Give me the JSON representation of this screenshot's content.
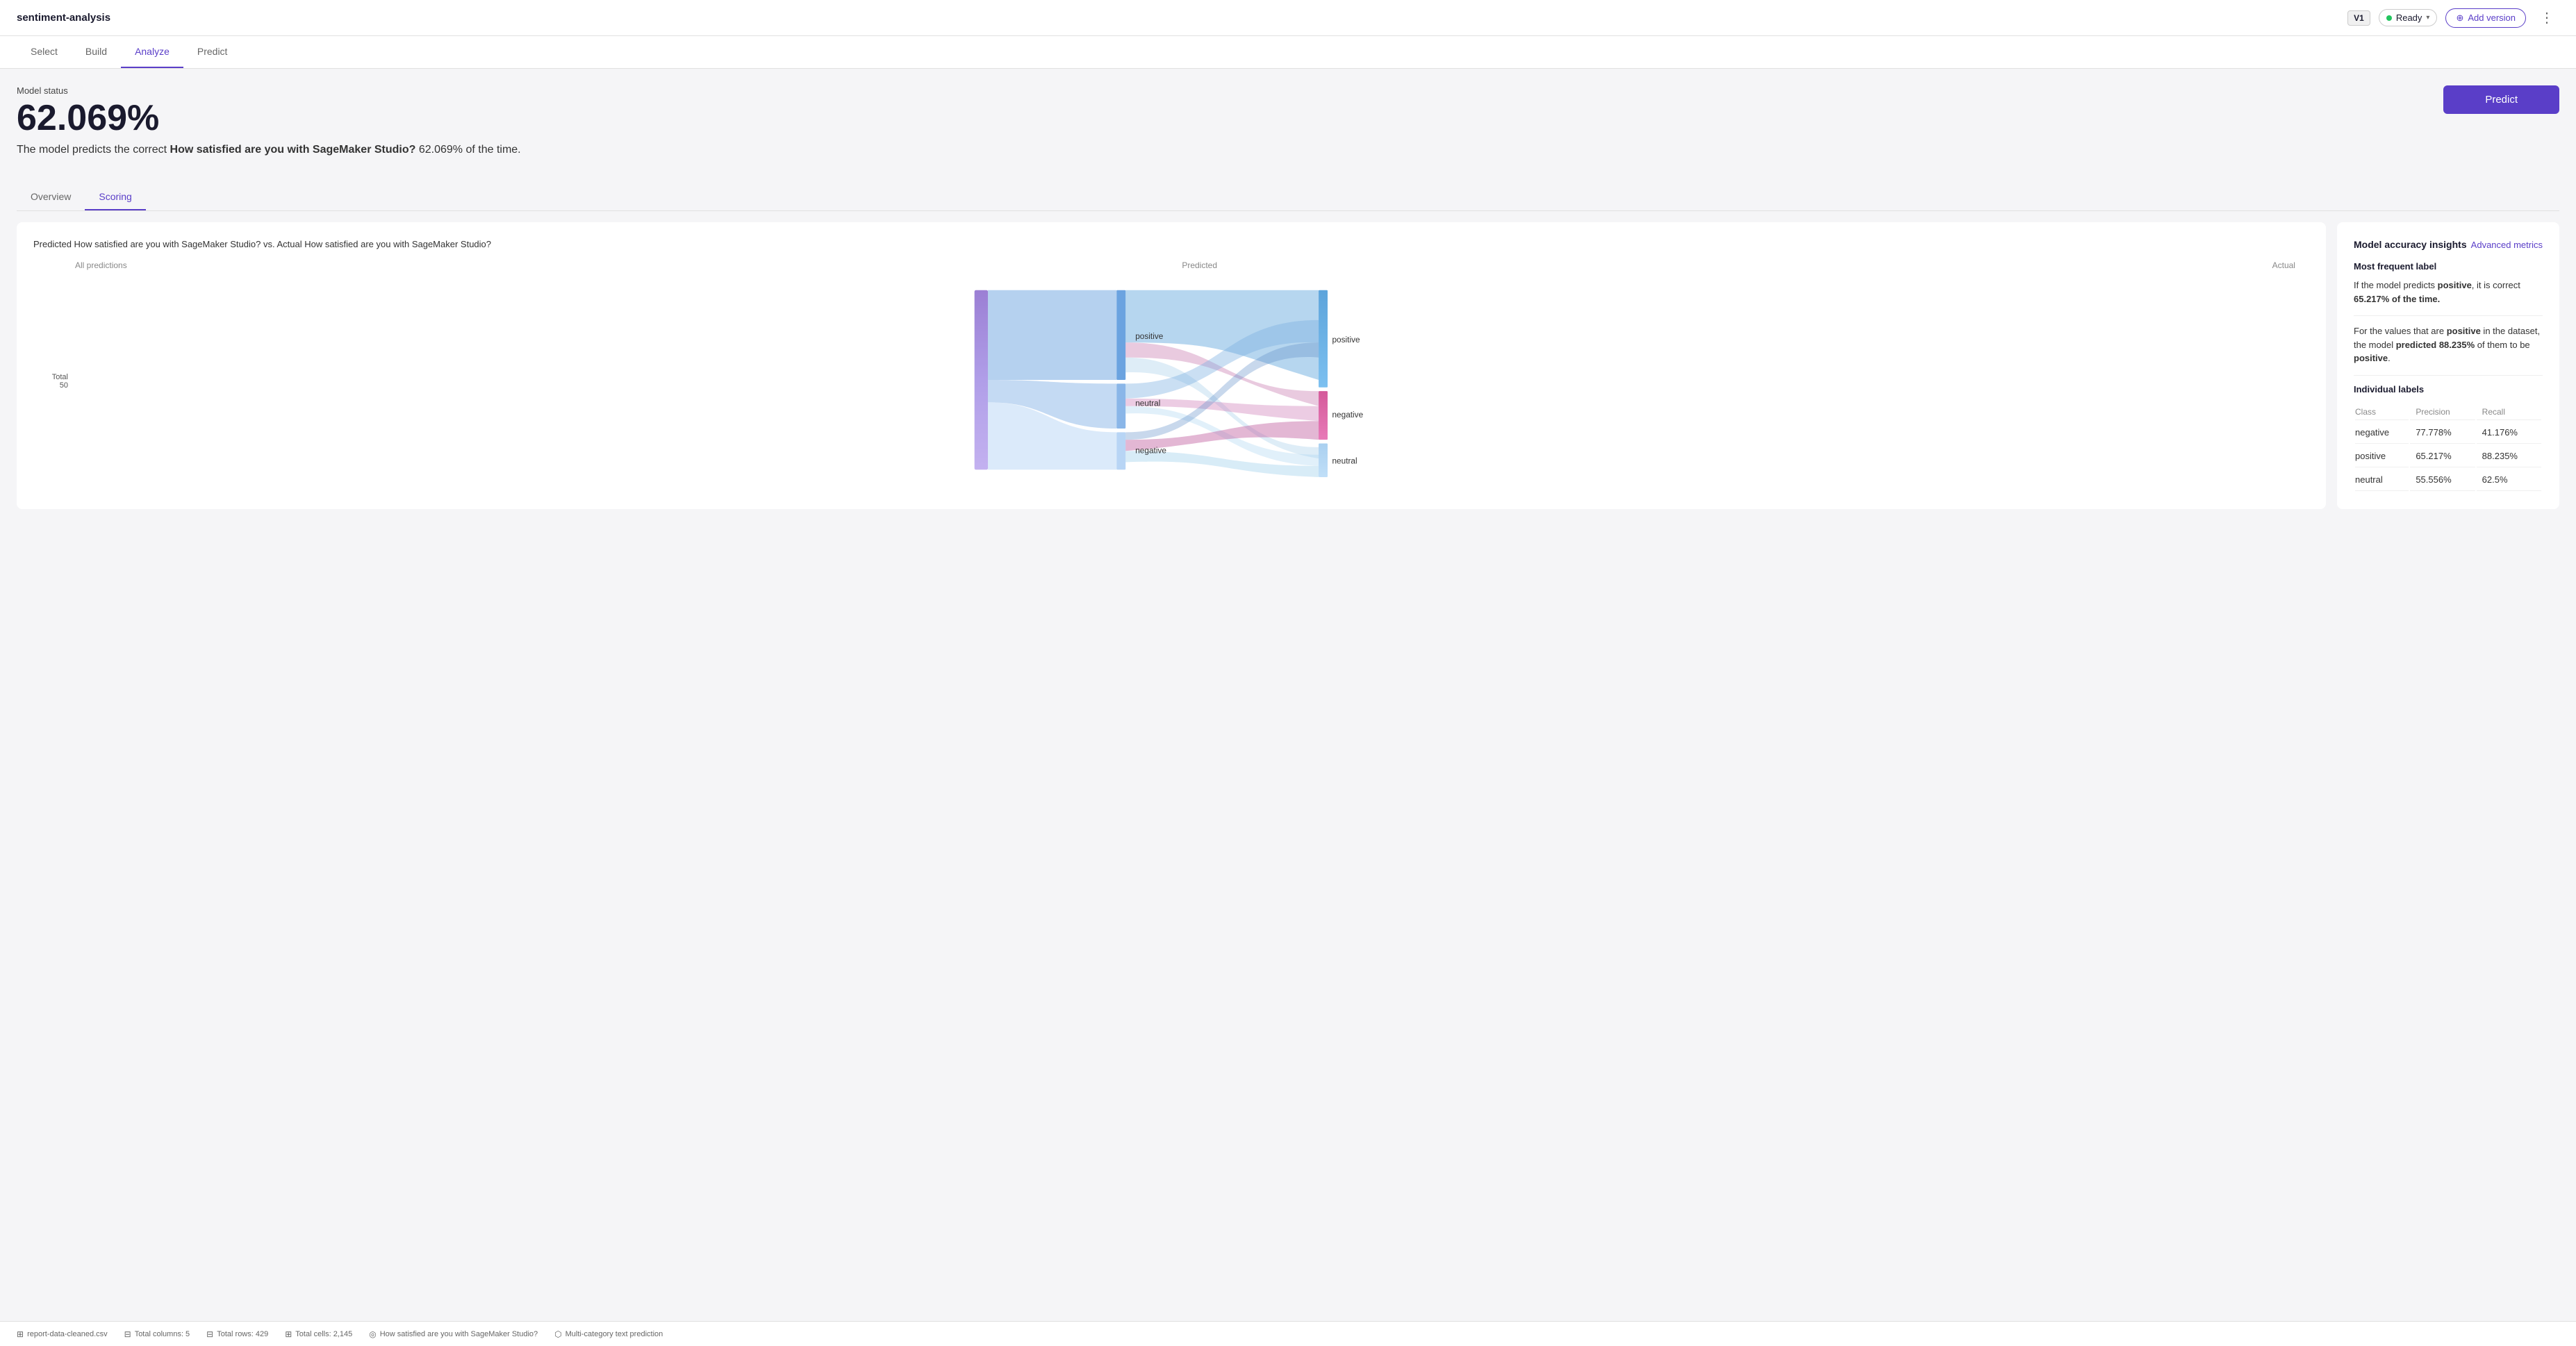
{
  "app": {
    "title": "sentiment-analysis"
  },
  "header": {
    "version": "V1",
    "status": "Ready",
    "add_version_label": "Add version"
  },
  "nav": {
    "tabs": [
      {
        "id": "select",
        "label": "Select",
        "active": false
      },
      {
        "id": "build",
        "label": "Build",
        "active": false
      },
      {
        "id": "analyze",
        "label": "Analyze",
        "active": true
      },
      {
        "id": "predict",
        "label": "Predict",
        "active": false
      }
    ]
  },
  "main": {
    "model_status_label": "Model status",
    "accuracy": "62.069%",
    "description_prefix": "The model predicts the correct ",
    "description_bold": "How satisfied are you with SageMaker Studio?",
    "description_suffix": " 62.069% of the time.",
    "predict_button": "Predict",
    "sub_tabs": [
      {
        "id": "overview",
        "label": "Overview",
        "active": false
      },
      {
        "id": "scoring",
        "label": "Scoring",
        "active": true
      }
    ]
  },
  "chart": {
    "title": "Predicted How satisfied are you with SageMaker Studio? vs. Actual How satisfied are you with SageMaker Studio?",
    "col_all_predictions": "All predictions",
    "col_predicted": "Predicted",
    "col_actual": "Actual",
    "total_label": "Total",
    "total_value": "50",
    "labels_predicted": [
      "positive",
      "neutral",
      "negative"
    ],
    "labels_actual": [
      "positive",
      "negative",
      "neutral"
    ]
  },
  "metrics": {
    "section_title": "Model accuracy insights",
    "advanced_link": "Advanced metrics",
    "most_frequent_label": "Most frequent label",
    "insight1": "If the model predicts positive, it is correct 65.217% of the time.",
    "insight1_bold1": "positive",
    "insight1_bold2": "65.217% of the time.",
    "insight2_prefix": "For the values that are ",
    "insight2_bold1": "positive",
    "insight2_middle": " in the dataset, the model ",
    "insight2_bold2": "predicted 88.235%",
    "insight2_suffix": " of them to be ",
    "insight2_bold3": "positive",
    "insight2_end": ".",
    "individual_labels": "Individual labels",
    "table_headers": [
      "Class",
      "Precision",
      "Recall"
    ],
    "table_rows": [
      {
        "class": "negative",
        "precision": "77.778%",
        "recall": "41.176%"
      },
      {
        "class": "positive",
        "precision": "65.217%",
        "recall": "88.235%"
      },
      {
        "class": "neutral",
        "precision": "55.556%",
        "recall": "62.5%"
      }
    ]
  },
  "footer": {
    "file": "report-data-cleaned.csv",
    "columns": "Total columns: 5",
    "rows": "Total rows: 429",
    "cells": "Total cells: 2,145",
    "target": "How satisfied are you with SageMaker Studio?",
    "type": "Multi-category text prediction"
  }
}
